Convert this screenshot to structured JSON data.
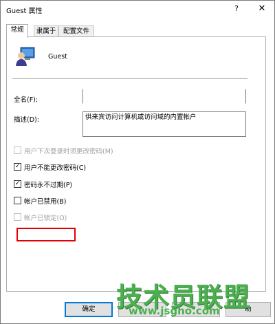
{
  "window": {
    "title": "Guest 属性",
    "help_glyph": "?",
    "close_glyph": "✕"
  },
  "tabs": [
    {
      "label": "常规",
      "active": true
    },
    {
      "label": "隶属于",
      "active": false
    },
    {
      "label": "配置文件",
      "active": false
    }
  ],
  "general": {
    "username": "Guest",
    "fullname_label": "全名(F):",
    "fullname_value": "",
    "description_label": "描述(D):",
    "description_value": "供来宾访问计算机或访问域的内置帐户"
  },
  "checkboxes": [
    {
      "label": "用户下次登录时须更改密码(M)",
      "checked": false,
      "enabled": false
    },
    {
      "label": "用户不能更改密码(C)",
      "checked": true,
      "enabled": true
    },
    {
      "label": "密码永不过期(P)",
      "checked": true,
      "enabled": true
    },
    {
      "label": "帐户已禁用(B)",
      "checked": false,
      "enabled": true
    },
    {
      "label": "帐户已锁定(O)",
      "checked": false,
      "enabled": false
    }
  ],
  "buttons": {
    "ok": "确定",
    "cancel": "",
    "apply": "",
    "help": "助"
  },
  "watermark": {
    "text": "技术员联盟",
    "url": "www.jsgho.com"
  },
  "colors": {
    "highlight_box": "#e00000",
    "default_button_border": "#0078d7",
    "watermark": "#4caf50"
  }
}
